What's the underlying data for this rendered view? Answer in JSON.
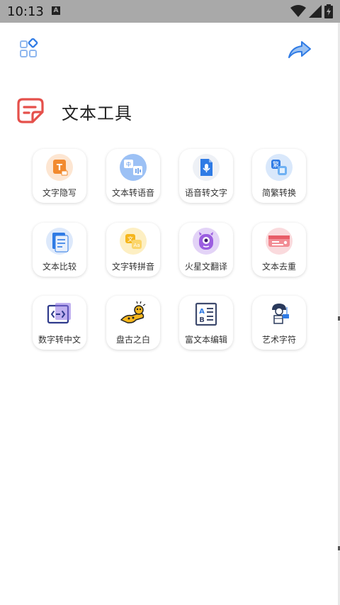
{
  "status_bar": {
    "time": "10:13",
    "notification_icon": "A"
  },
  "page": {
    "title": "文本工具"
  },
  "tools": [
    {
      "label": "文字隐写"
    },
    {
      "label": "文本转语音"
    },
    {
      "label": "语音转文字"
    },
    {
      "label": "简繁转换"
    },
    {
      "label": "文本比较"
    },
    {
      "label": "文字转拼音"
    },
    {
      "label": "火星文翻译"
    },
    {
      "label": "文本去重"
    },
    {
      "label": "数字转中文"
    },
    {
      "label": "盘古之白"
    },
    {
      "label": "富文本编辑"
    },
    {
      "label": "艺术字符"
    }
  ],
  "colors": {
    "accent": "#2f7be5",
    "title_icon": "#e5504b",
    "status_bar": "#a9a9a9"
  }
}
